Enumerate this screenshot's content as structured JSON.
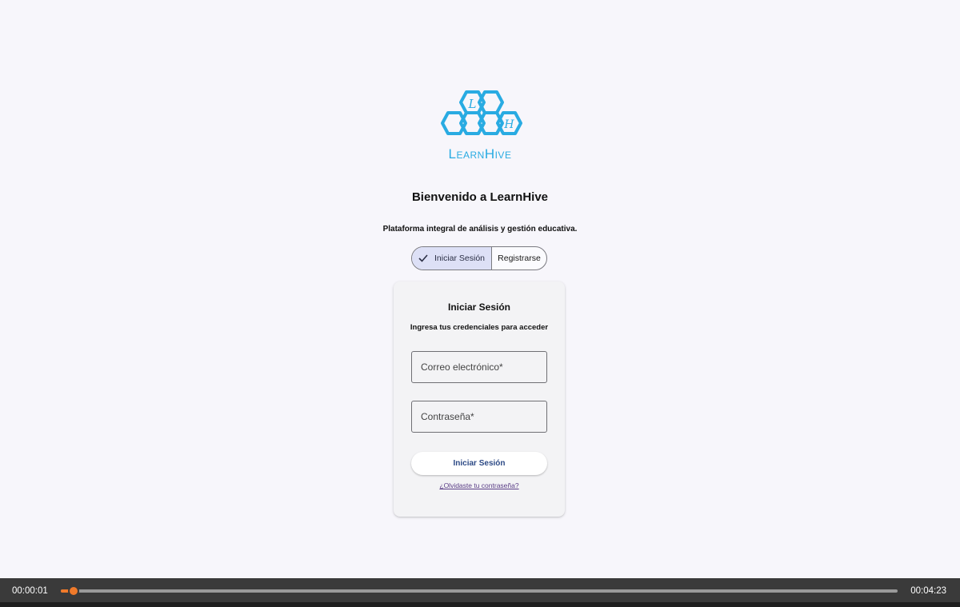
{
  "brand": {
    "logo_text": "LearnHive",
    "logo_letters": [
      "L",
      "H"
    ],
    "logo_color": "#29abe2"
  },
  "header": {
    "welcome": "Bienvenido a LearnHive",
    "subtitle": "Plataforma integral de análisis y gestión educativa."
  },
  "mode_toggle": {
    "login_label": "Iniciar Sesión",
    "register_label": "Registrarse",
    "selected": "login",
    "selected_icon": "check-icon"
  },
  "login_card": {
    "title": "Iniciar Sesión",
    "subtitle": "Ingresa tus credenciales para acceder",
    "email_placeholder": "Correo electrónico*",
    "email_value": "",
    "password_placeholder": "Contraseña*",
    "password_value": "",
    "submit_label": "Iniciar Sesión",
    "forgot_link": "¿Olvidaste tu contraseña?"
  },
  "video_player": {
    "current_time": "00:00:01",
    "total_time": "00:04:23",
    "progress": 0.015,
    "accent_color": "#f07a2a"
  },
  "colors": {
    "background": "#f7f6fb",
    "toggle_active": "#dde0f6",
    "card": "#f3f3f5",
    "button_text": "#2d4a86"
  }
}
